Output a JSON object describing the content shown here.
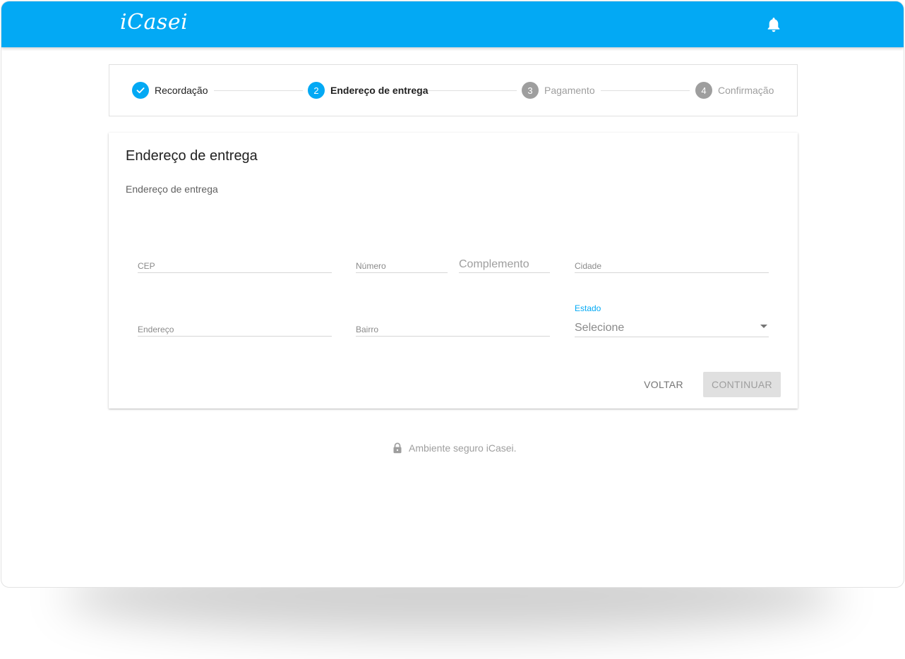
{
  "app": {
    "logo_text": "iCasei"
  },
  "header": {
    "notification_icon": "bell-icon"
  },
  "stepper": {
    "steps": [
      {
        "number": "",
        "label": "Recordação",
        "status": "done",
        "icon": "check-icon"
      },
      {
        "number": "2",
        "label": "Endereço de entrega",
        "status": "current"
      },
      {
        "number": "3",
        "label": "Pagamento",
        "status": "pending"
      },
      {
        "number": "4",
        "label": "Confirmação",
        "status": "pending"
      }
    ]
  },
  "card": {
    "title": "Endereço de entrega",
    "subtitle": "Endereço de entrega"
  },
  "form": {
    "cep": {
      "placeholder": "CEP",
      "value": ""
    },
    "numero": {
      "placeholder": "Número",
      "value": ""
    },
    "complemento": {
      "placeholder": "Complemento",
      "value": ""
    },
    "cidade": {
      "placeholder": "Cidade",
      "value": ""
    },
    "endereco": {
      "placeholder": "Endereço",
      "value": ""
    },
    "bairro": {
      "placeholder": "Bairro",
      "value": ""
    },
    "estado": {
      "label": "Estado",
      "selected": "Selecione"
    }
  },
  "actions": {
    "back_label": "VOLTAR",
    "continue_label": "CONTINUAR"
  },
  "footer": {
    "secure_text": "Ambiente seguro iCasei.",
    "lock_icon": "lock-icon"
  },
  "colors": {
    "primary": "#03a9f4",
    "inactive_step": "#9e9e9e",
    "disabled_button": "#e0e0e0"
  }
}
